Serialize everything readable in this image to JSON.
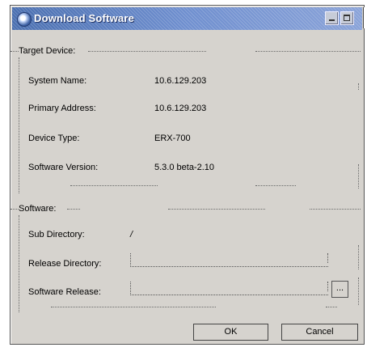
{
  "window": {
    "title": "Download Software"
  },
  "target_device": {
    "group_label": "Target Device:",
    "rows": [
      {
        "label": "System Name:",
        "value": "10.6.129.203"
      },
      {
        "label": "Primary Address:",
        "value": "10.6.129.203"
      },
      {
        "label": "Device Type:",
        "value": "ERX-700"
      },
      {
        "label": "Software Version:",
        "value": "5.3.0 beta-2.10"
      }
    ]
  },
  "software": {
    "group_label": "Software:",
    "sub_directory": {
      "label": "Sub Directory:",
      "value": "/"
    },
    "release_directory": {
      "label": "Release Directory:",
      "value": ""
    },
    "software_release": {
      "label": "Software Release:",
      "value": "",
      "browse_label": "..."
    }
  },
  "buttons": {
    "ok": "OK",
    "cancel": "Cancel"
  }
}
